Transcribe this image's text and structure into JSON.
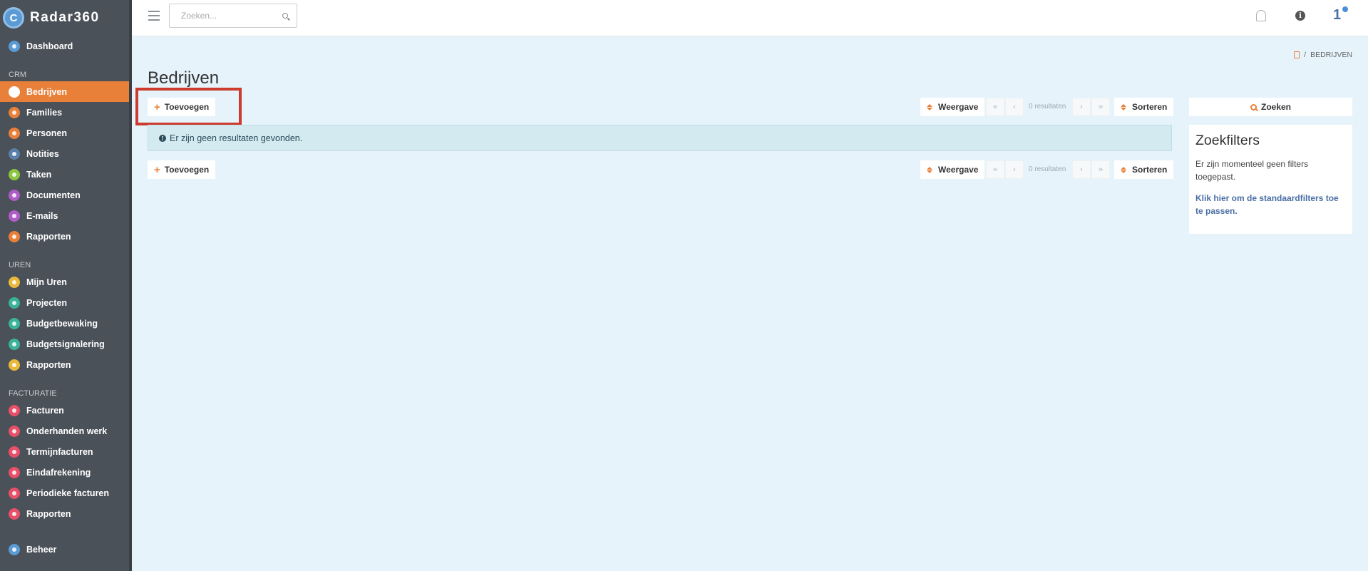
{
  "app": {
    "name": "Radar360",
    "logo_letter": "C"
  },
  "sidebar": {
    "top_item": {
      "label": "Dashboard",
      "icon": "dashboard-icon",
      "color": "#5b9bd5"
    },
    "sections": [
      {
        "title": "CRM",
        "items": [
          {
            "label": "Bedrijven",
            "icon": "building-icon",
            "color": "#ffffff",
            "active": true
          },
          {
            "label": "Families",
            "icon": "families-icon",
            "color": "#e8803a"
          },
          {
            "label": "Personen",
            "icon": "person-icon",
            "color": "#e8803a"
          },
          {
            "label": "Notities",
            "icon": "notes-icon",
            "color": "#5a7fa8"
          },
          {
            "label": "Taken",
            "icon": "tasks-icon",
            "color": "#8cc63f"
          },
          {
            "label": "Documenten",
            "icon": "documents-icon",
            "color": "#b05cc9"
          },
          {
            "label": "E-mails",
            "icon": "email-icon",
            "color": "#b05cc9"
          },
          {
            "label": "Rapporten",
            "icon": "reports-icon",
            "color": "#e8803a"
          }
        ]
      },
      {
        "title": "UREN",
        "items": [
          {
            "label": "Mijn Uren",
            "icon": "clock-icon",
            "color": "#e8b93a"
          },
          {
            "label": "Projecten",
            "icon": "projects-icon",
            "color": "#3ab39a"
          },
          {
            "label": "Budgetbewaking",
            "icon": "budget-icon",
            "color": "#3ab39a"
          },
          {
            "label": "Budgetsignalering",
            "icon": "signal-icon",
            "color": "#3ab39a"
          },
          {
            "label": "Rapporten",
            "icon": "reports-icon",
            "color": "#e8b93a"
          }
        ]
      },
      {
        "title": "FACTURATIE",
        "items": [
          {
            "label": "Facturen",
            "icon": "invoice-icon",
            "color": "#e8506a"
          },
          {
            "label": "Onderhanden werk",
            "icon": "work-icon",
            "color": "#e8506a"
          },
          {
            "label": "Termijnfacturen",
            "icon": "term-invoice-icon",
            "color": "#e8506a"
          },
          {
            "label": "Eindafrekening",
            "icon": "final-settlement-icon",
            "color": "#e8506a"
          },
          {
            "label": "Periodieke facturen",
            "icon": "periodic-invoice-icon",
            "color": "#e8506a"
          },
          {
            "label": "Rapporten",
            "icon": "reports-icon",
            "color": "#e8506a"
          }
        ]
      }
    ],
    "bottom_item": {
      "label": "Beheer",
      "icon": "settings-icon",
      "color": "#5b9bd5"
    }
  },
  "topbar": {
    "search_placeholder": "Zoeken...",
    "user_count": "1"
  },
  "breadcrumb": {
    "separator": "/",
    "current": "BEDRIJVEN"
  },
  "page": {
    "title": "Bedrijven",
    "add_label": "Toevoegen",
    "view_label": "Weergave",
    "results_label": "0 resultaten",
    "sort_label": "Sorteren",
    "pager": {
      "first": "«",
      "prev": "‹",
      "next": "›",
      "last": "»"
    },
    "empty_message": "Er zijn geen resultaten gevonden."
  },
  "filters": {
    "search_label": "Zoeken",
    "title": "Zoekfilters",
    "no_filters_text": "Er zijn momenteel geen filters toegepast.",
    "default_link": "Klik hier om de standaardfilters toe te passen."
  },
  "accent_color": "#e8803a"
}
